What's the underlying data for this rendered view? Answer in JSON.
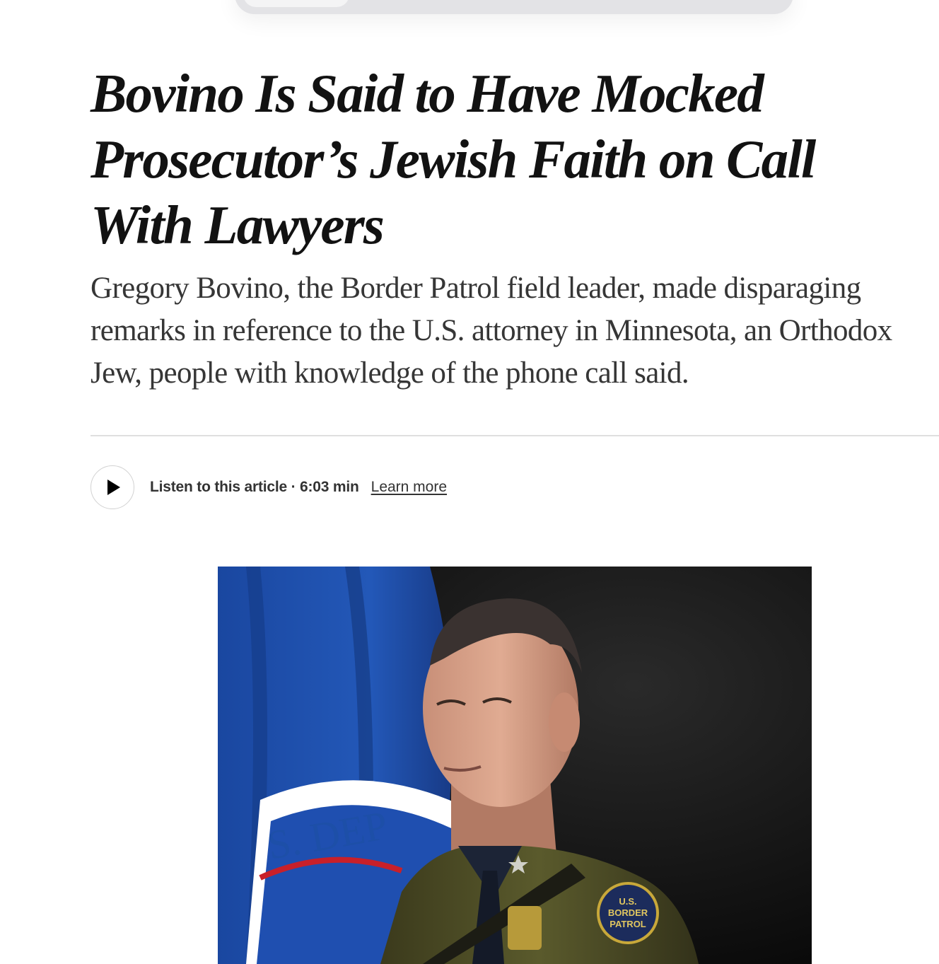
{
  "article": {
    "headline": "Bovino Is Said to Have Mocked Prosecutor’s Jewish Faith on Call With Lawyers",
    "summary": "Gregory Bovino, the Border Patrol field leader, made disparaging remarks in reference to the U.S. attorney in Minnesota, an Orthodox Jew, people with knowledge of the phone call said."
  },
  "audio": {
    "play_icon": "play-icon",
    "listen_label": "Listen to this article · 6:03 min",
    "learn_more_label": "Learn more"
  },
  "photo": {
    "flag_seal_text": "S. DEP",
    "patch_line1": "U.S.",
    "patch_line2": "BORDER",
    "patch_line3": "PATROL"
  },
  "colors": {
    "headline": "#121212",
    "summary": "#363636",
    "flag_blue": "#1d4fa8",
    "uniform_green": "#4a4a24"
  }
}
